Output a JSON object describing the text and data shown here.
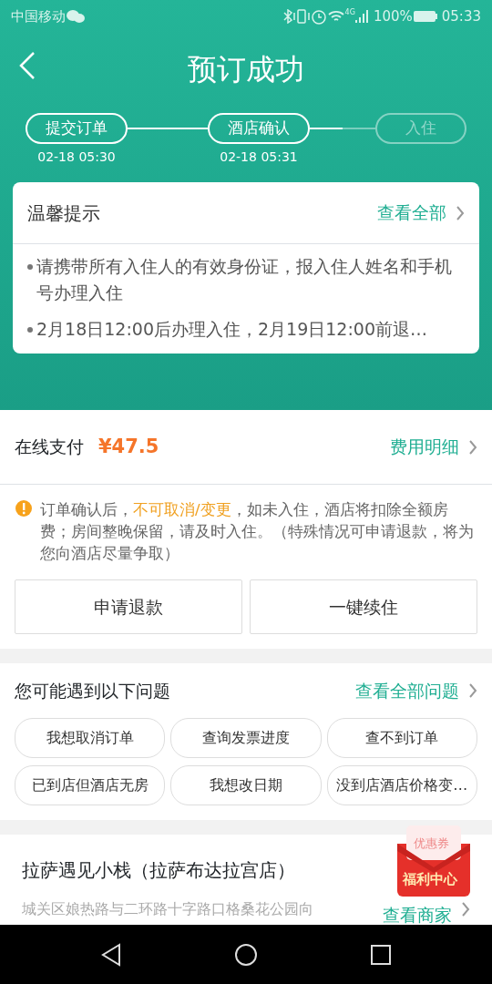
{
  "status_bar": {
    "carrier": "中国移动",
    "network": "4G",
    "battery": "100%",
    "time": "05:33"
  },
  "header": {
    "title": "预订成功"
  },
  "steps": [
    {
      "label": "提交订单",
      "done": true,
      "time": "02-18 05:30"
    },
    {
      "label": "酒店确认",
      "done": true,
      "time": "02-18 05:31"
    },
    {
      "label": "入住",
      "done": false
    }
  ],
  "tips": {
    "title": "温馨提示",
    "link": "查看全部",
    "items": [
      "请携带所有入住人的有效身份证，报入住人姓名和手机号办理入住",
      "2月18日12:00后办理入住，2月19日12:00前退…"
    ]
  },
  "payment": {
    "label": "在线支付",
    "amount": "¥47.5",
    "link": "费用明细"
  },
  "notice": "订单确认后，**不可取消/变更**，如未入住，酒店将扣除全额房费；房间整晚保留，请及时入住。（特殊情况可申请退款，将为您向酒店尽量争取）",
  "actions": [
    "申请退款",
    "一键续住"
  ],
  "questions": {
    "title": "您可能遇到以下问题",
    "link": "查看全部问题",
    "chips": [
      "我想取消订单",
      "查询发票进度",
      "查不到订单",
      "已到店但酒店无房",
      "我想改日期",
      "没到店酒店价格变…"
    ]
  },
  "hotel": {
    "name": "拉萨遇见小栈（拉萨布达拉宫店）",
    "address": "城关区娘热路与二环路十字路口格桑花公园向",
    "link": "查看商家"
  },
  "promo": {
    "coupon": "优惠券",
    "label": "福利中心"
  }
}
